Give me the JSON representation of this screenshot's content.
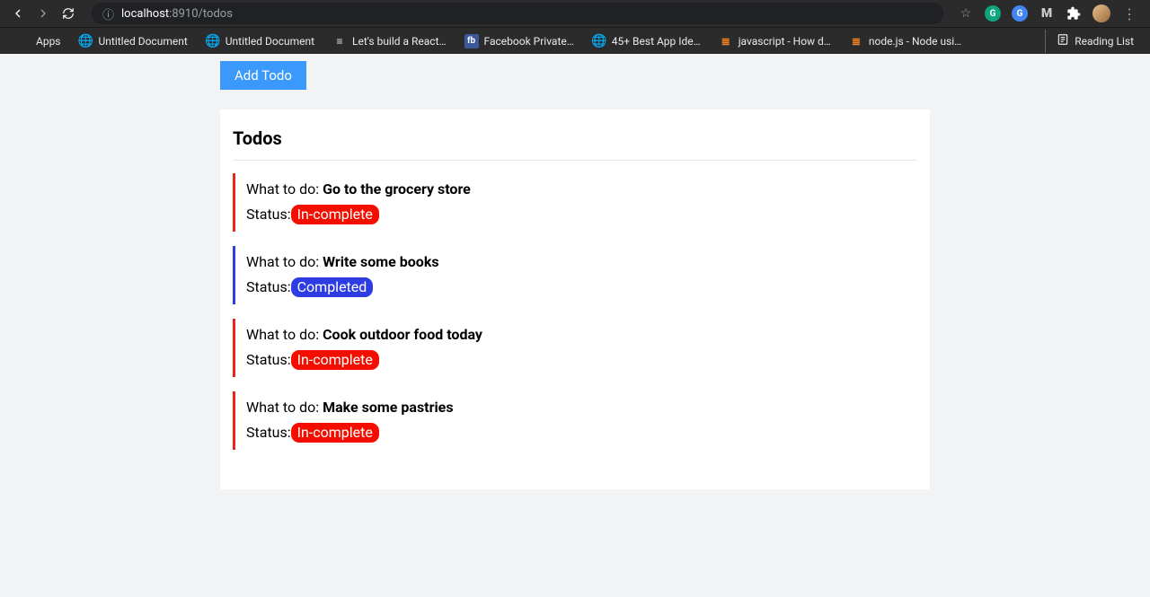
{
  "browser": {
    "url_host": "localhost",
    "url_port": ":8910",
    "url_path": "/todos"
  },
  "bookmarks": {
    "apps": "Apps",
    "items": [
      "Untitled Document",
      "Untitled Document",
      "Let's build a React…",
      "Facebook Private…",
      "45+ Best App Ide…",
      "javascript - How d…",
      "node.js - Node usi…"
    ],
    "reading_list": "Reading List"
  },
  "page": {
    "add_button": "Add Todo",
    "heading": "Todos",
    "what_label": "What to do: ",
    "status_label": "Status:",
    "todos": [
      {
        "title": "Go to the grocery store",
        "status": "In-complete",
        "done": false
      },
      {
        "title": "Write some books",
        "status": "Completed",
        "done": true
      },
      {
        "title": "Cook outdoor food today",
        "status": "In-complete",
        "done": false
      },
      {
        "title": "Make some pastries",
        "status": "In-complete",
        "done": false
      }
    ]
  }
}
